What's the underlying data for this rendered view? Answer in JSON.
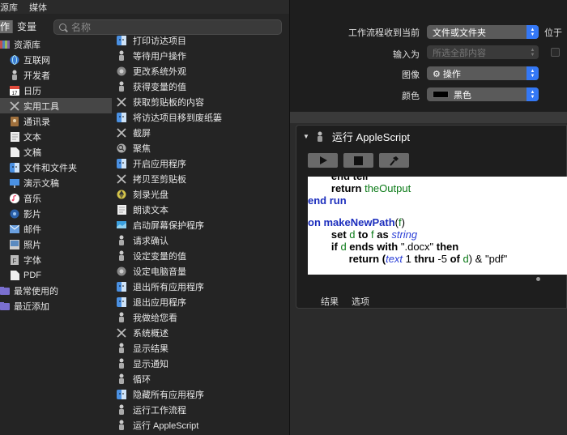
{
  "top_tabs": [
    "源库",
    "媒体"
  ],
  "segments": {
    "actions_label": "作",
    "variables_label": "变量"
  },
  "search": {
    "placeholder": "名称"
  },
  "library": [
    {
      "label": "资源库",
      "icon": "library-icon",
      "color": "#8a8a8a"
    },
    {
      "label": "互联网",
      "icon": "globe-icon",
      "color": "#3a7bd5"
    },
    {
      "label": "开发者",
      "icon": "developer-icon",
      "color": "#555"
    },
    {
      "label": "日历",
      "icon": "calendar-icon",
      "color": "#e04b3c"
    },
    {
      "label": "实用工具",
      "icon": "tools-icon",
      "color": "#888",
      "selected": true
    },
    {
      "label": "通讯录",
      "icon": "contacts-icon",
      "color": "#a0703c"
    },
    {
      "label": "文本",
      "icon": "text-icon",
      "color": "#ddd"
    },
    {
      "label": "文稿",
      "icon": "document-icon",
      "color": "#ddd"
    },
    {
      "label": "文件和文件夹",
      "icon": "finder-icon",
      "color": "#4a90e2"
    },
    {
      "label": "演示文稿",
      "icon": "keynote-icon",
      "color": "#4a90e2"
    },
    {
      "label": "音乐",
      "icon": "music-icon",
      "color": "#f04e6e"
    },
    {
      "label": "影片",
      "icon": "movie-icon",
      "color": "#3a7bd5"
    },
    {
      "label": "邮件",
      "icon": "mail-icon",
      "color": "#6aa0e0"
    },
    {
      "label": "照片",
      "icon": "photos-icon",
      "color": "#9a9a9a"
    },
    {
      "label": "字体",
      "icon": "font-icon",
      "color": "#7a7a7a"
    },
    {
      "label": "PDF",
      "icon": "pdf-icon",
      "color": "#ddd"
    },
    {
      "label": "最常使用的",
      "icon": "smart-folder-icon",
      "color": "#7a6fd0"
    },
    {
      "label": "最近添加",
      "icon": "smart-folder-icon",
      "color": "#7a6fd0"
    }
  ],
  "actions": [
    {
      "label": "打印访达项目",
      "icon": "finder-icon",
      "color": "#4a90e2"
    },
    {
      "label": "等待用户操作",
      "icon": "automator-icon",
      "color": "#999"
    },
    {
      "label": "更改系统外观",
      "icon": "system-prefs-icon",
      "color": "#888"
    },
    {
      "label": "获得变量的值",
      "icon": "automator-icon",
      "color": "#999"
    },
    {
      "label": "获取剪贴板的内容",
      "icon": "tools-icon",
      "color": "#888"
    },
    {
      "label": "将访达项目移到废纸篓",
      "icon": "finder-icon",
      "color": "#4a90e2"
    },
    {
      "label": "截屏",
      "icon": "tools-icon",
      "color": "#888"
    },
    {
      "label": "聚焦",
      "icon": "spotlight-icon",
      "color": "#aaa"
    },
    {
      "label": "开启应用程序",
      "icon": "finder-icon",
      "color": "#4a90e2"
    },
    {
      "label": "拷贝至剪贴板",
      "icon": "tools-icon",
      "color": "#888"
    },
    {
      "label": "刻录光盘",
      "icon": "burn-icon",
      "color": "#d4c44a"
    },
    {
      "label": "朗读文本",
      "icon": "text-icon",
      "color": "#ddd"
    },
    {
      "label": "启动屏幕保护程序",
      "icon": "screensaver-icon",
      "color": "#3aa0e0"
    },
    {
      "label": "请求确认",
      "icon": "automator-icon",
      "color": "#999"
    },
    {
      "label": "设定变量的值",
      "icon": "automator-icon",
      "color": "#999"
    },
    {
      "label": "设定电脑音量",
      "icon": "system-prefs-icon",
      "color": "#888"
    },
    {
      "label": "退出所有应用程序",
      "icon": "finder-icon",
      "color": "#4a90e2"
    },
    {
      "label": "退出应用程序",
      "icon": "finder-icon",
      "color": "#4a90e2"
    },
    {
      "label": "我做给您看",
      "icon": "automator-icon",
      "color": "#999"
    },
    {
      "label": "系统概述",
      "icon": "tools-icon",
      "color": "#888"
    },
    {
      "label": "显示结果",
      "icon": "automator-icon",
      "color": "#999"
    },
    {
      "label": "显示通知",
      "icon": "automator-icon",
      "color": "#999"
    },
    {
      "label": "循环",
      "icon": "automator-icon",
      "color": "#999"
    },
    {
      "label": "隐藏所有应用程序",
      "icon": "finder-icon",
      "color": "#4a90e2"
    },
    {
      "label": "运行工作流程",
      "icon": "automator-icon",
      "color": "#999"
    },
    {
      "label": "运行 AppleScript",
      "icon": "automator-icon",
      "color": "#999"
    }
  ],
  "workflow_header": {
    "receives_label": "工作流程收到当前",
    "receives_value": "文件或文件夹",
    "in_label": "位于",
    "input_label": "输入为",
    "input_value": "所选全部内容",
    "image_label": "图像",
    "image_value": "⚙ 操作",
    "color_label": "颜色",
    "color_value": "黑色"
  },
  "action_block": {
    "title": "运行 AppleScript",
    "results_tab": "结果",
    "options_tab": "选项"
  },
  "code_lines": [
    [
      "        ",
      "end tell"
    ],
    [
      "        return ",
      "theOutput"
    ],
    [
      "end ",
      "run"
    ],
    [
      ""
    ],
    [
      "on ",
      "makeNewPath",
      "(",
      "f",
      ")"
    ],
    [
      "        set ",
      "d",
      " to ",
      "f",
      " as ",
      "string"
    ],
    [
      "        if ",
      "d",
      " ends with ",
      "\".docx\"",
      " then"
    ],
    [
      "              return (",
      "text",
      " 1 ",
      "thru",
      " -5 ",
      "of",
      " ",
      "d",
      ") & \"pdf\""
    ]
  ],
  "colors": {
    "accent": "#3478f6",
    "background": "#1e1e1e",
    "sidebar": "#242424"
  }
}
